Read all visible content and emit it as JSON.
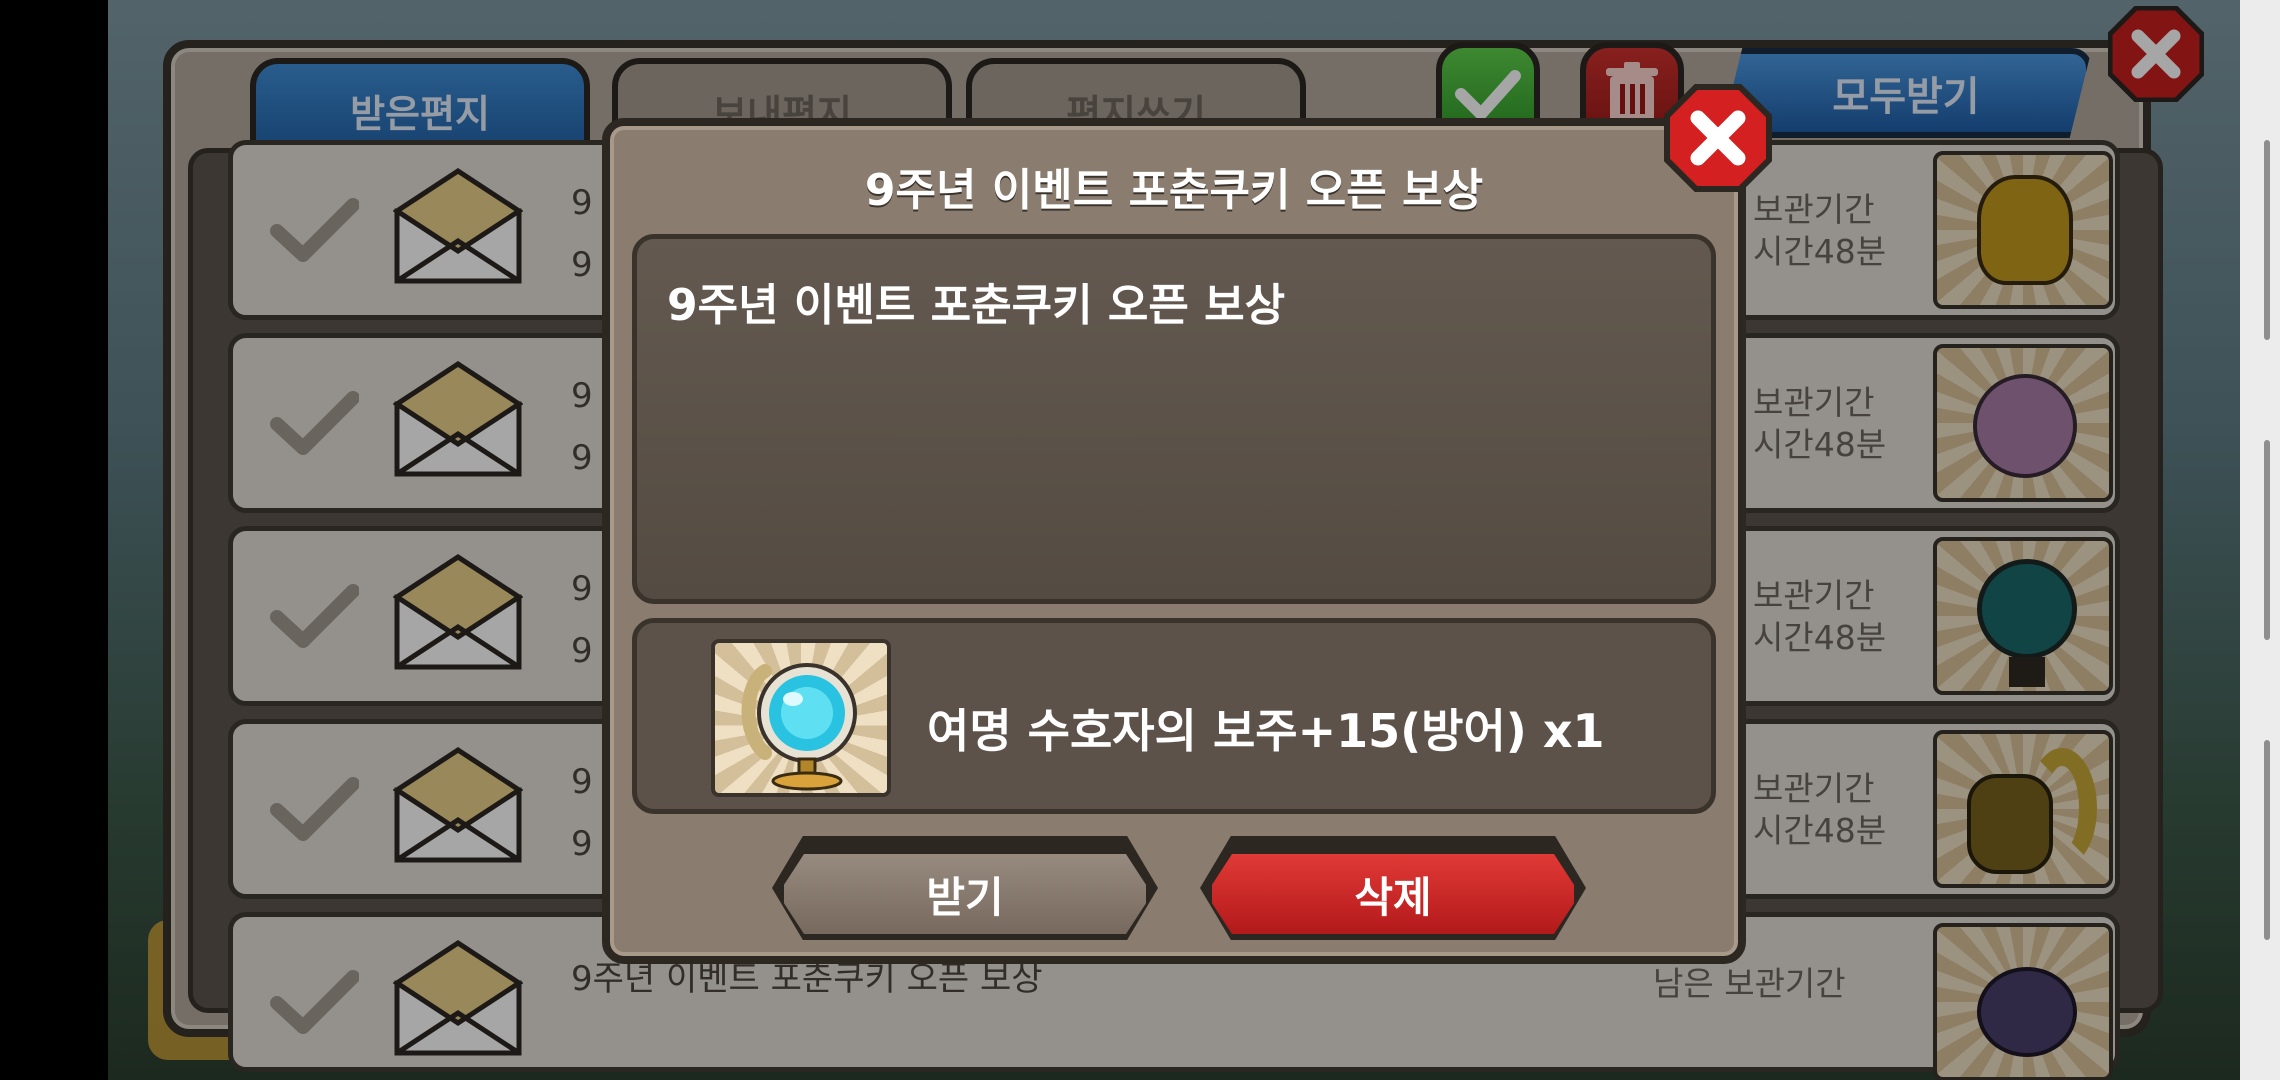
{
  "mailbox": {
    "tabs": [
      {
        "label": "받은편지"
      },
      {
        "label": "보내편지"
      },
      {
        "label": "편지쓰기"
      }
    ],
    "receive_all_label": "모두받기",
    "rows": [
      {
        "frag_top": "9",
        "frag_bottom": "9",
        "remain_line1": "보관기간",
        "remain_line2": "시간48분"
      },
      {
        "frag_top": "9",
        "frag_bottom": "9",
        "remain_line1": "보관기간",
        "remain_line2": "시간48분"
      },
      {
        "frag_top": "9",
        "frag_bottom": "9",
        "remain_line1": "보관기간",
        "remain_line2": "시간48분"
      },
      {
        "frag_top": "9",
        "frag_bottom": "9",
        "remain_line1": "보관기간",
        "remain_line2": "시간48분"
      },
      {
        "title": "9주년 이벤트 포춘쿠키 오픈 보상",
        "remain_line1": "남은 보관기간",
        "remain_line2": ""
      }
    ]
  },
  "dialog": {
    "title": "9주년 이벤트 포춘쿠키 오픈 보상",
    "body": "9주년 이벤트 포춘쿠키 오픈 보상",
    "reward_text": "여명 수호자의 보주+15(방어) x1",
    "receive_label": "받기",
    "delete_label": "삭제"
  },
  "colors": {
    "tab_active": "#2f7ac4",
    "delete_button": "#c62222",
    "receive_button": "#887b6f",
    "dialog_bg": "#8a7d70"
  },
  "icons": [
    "check-icon",
    "envelope-icon",
    "trash-icon",
    "close-icon",
    "orb-icon"
  ]
}
